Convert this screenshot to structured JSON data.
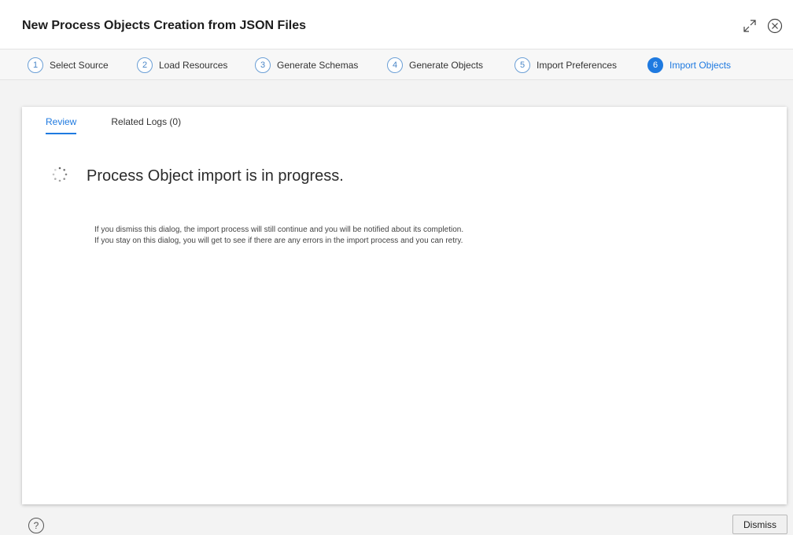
{
  "dialog": {
    "title": "New Process Objects Creation from JSON Files",
    "expand_icon": "expand-icon",
    "close_icon": "close-circle-icon"
  },
  "steps": [
    {
      "num": "1",
      "label": "Select Source",
      "active": false
    },
    {
      "num": "2",
      "label": "Load Resources",
      "active": false
    },
    {
      "num": "3",
      "label": "Generate Schemas",
      "active": false
    },
    {
      "num": "4",
      "label": "Generate Objects",
      "active": false
    },
    {
      "num": "5",
      "label": "Import Preferences",
      "active": false
    },
    {
      "num": "6",
      "label": "Import Objects",
      "active": true
    }
  ],
  "tabs": {
    "review": "Review",
    "related_logs": "Related Logs (0)"
  },
  "progress": {
    "message": "Process Object import is in progress.",
    "spinner_icon": "spinner-icon"
  },
  "info": {
    "line1": "If you dismiss this dialog, the import process will still continue and you will be notified about its completion.",
    "line2": "If you stay on this dialog, you will get to see if there are any errors in the import process and you can retry."
  },
  "footer": {
    "help_label": "?",
    "dismiss_label": "Dismiss"
  },
  "colors": {
    "accent": "#1f7ae0",
    "step_outline": "#6b9fd6"
  }
}
